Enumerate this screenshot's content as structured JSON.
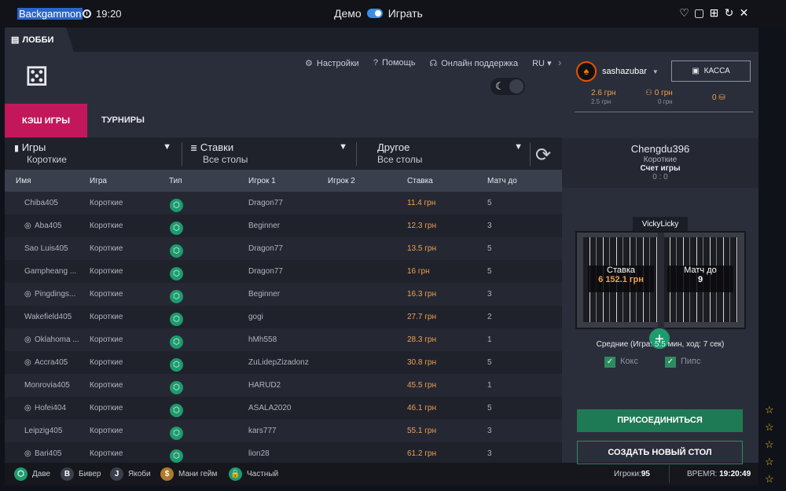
{
  "window": {
    "title": "Backgammon",
    "time": "19:20",
    "mode_demo": "Демо",
    "mode_play": "Играть"
  },
  "tabbar": {
    "lobby": "ЛОББИ"
  },
  "nav": {
    "settings": "Настройки",
    "help": "Помощь",
    "support": "Онлайн поддержка",
    "lang": "RU"
  },
  "tabs": {
    "cash": "КЭШ ИГРЫ",
    "tournaments": "ТУРНИРЫ"
  },
  "filters": [
    {
      "label": "Игры",
      "value": "Короткие"
    },
    {
      "label": "Ставки",
      "value": "Все столы"
    },
    {
      "label": "Другое",
      "value": "Все столы"
    }
  ],
  "columns": {
    "name": "Имя",
    "game": "Игра",
    "type": "Тип",
    "player1": "Игрок 1",
    "player2": "Игрок 2",
    "stake": "Ставка",
    "match": "Матч до"
  },
  "rows": [
    {
      "name": "Chiba405",
      "private": false,
      "game": "Короткие",
      "p1": "Dragon77",
      "stake": "11.4 грн",
      "match": "5"
    },
    {
      "name": "Aba405",
      "private": true,
      "game": "Короткие",
      "p1": "Beginner",
      "stake": "12.3 грн",
      "match": "3"
    },
    {
      "name": "Sao Luis405",
      "private": false,
      "game": "Короткие",
      "p1": "Dragon77",
      "stake": "13.5 грн",
      "match": "5"
    },
    {
      "name": "Gampheang ...",
      "private": false,
      "game": "Короткие",
      "p1": "Dragon77",
      "stake": "16 грн",
      "match": "5"
    },
    {
      "name": "Pingdings...",
      "private": true,
      "game": "Короткие",
      "p1": "Beginner",
      "stake": "16.3 грн",
      "match": "3"
    },
    {
      "name": "Wakefield405",
      "private": false,
      "game": "Короткие",
      "p1": "gogi",
      "stake": "27.7 грн",
      "match": "2"
    },
    {
      "name": "Oklahoma ...",
      "private": true,
      "game": "Короткие",
      "p1": "hMh558",
      "stake": "28.3 грн",
      "match": "1"
    },
    {
      "name": "Accra405",
      "private": true,
      "game": "Короткие",
      "p1": "ZuLidepZizadonz",
      "stake": "30.8 грн",
      "match": "5"
    },
    {
      "name": "Monrovia405",
      "private": false,
      "game": "Короткие",
      "p1": "HARUD2",
      "stake": "45.5 грн",
      "match": "1"
    },
    {
      "name": "Hofei404",
      "private": true,
      "game": "Короткие",
      "p1": "ASALA2020",
      "stake": "46.1 грн",
      "match": "5"
    },
    {
      "name": "Leipzig405",
      "private": false,
      "game": "Короткие",
      "p1": "kars777",
      "stake": "55.1 грн",
      "match": "3"
    },
    {
      "name": "Bari405",
      "private": true,
      "game": "Короткие",
      "p1": "lion28",
      "stake": "61.2 грн",
      "match": "3"
    }
  ],
  "legend": [
    {
      "icon": "⬡",
      "label": "Даве",
      "color": "#1e9b6e"
    },
    {
      "icon": "B",
      "label": "Бивер",
      "color": "#3a3f4d"
    },
    {
      "icon": "J",
      "label": "Якоби",
      "color": "#3a3f4d"
    },
    {
      "icon": "$",
      "label": "Мани гейм",
      "color": "#b07a2a"
    },
    {
      "icon": "🔒",
      "label": "Частный",
      "color": "#1e9b6e"
    }
  ],
  "status": {
    "players_label": "Игроки:",
    "players_value": "95",
    "time_label": "ВРЕМЯ:",
    "time_value": "19:20:49"
  },
  "account": {
    "username": "sashazubar",
    "cashier": "КАССА",
    "balance_main": "2.6 грн",
    "balance_sub": "2.5 грн",
    "chips": "0 грн",
    "chips_sub": "0 грн",
    "coins": "0"
  },
  "table": {
    "name": "Chengdu396",
    "type": "Короткие",
    "score_label": "Счет игры",
    "score": "0 : 0",
    "player": "VickyLicky",
    "stake_label": "Ставка",
    "stake_value": "6 152.1 грн",
    "match_label": "Матч до",
    "match_value": "9",
    "average": "Средние (Игра: 5.5 мин, ход: 7 сек)",
    "check_cox": "Кокс",
    "check_pips": "Пипс",
    "join": "ПРИСОЕДИНИТЬСЯ",
    "create": "СОЗДАТЬ НОВЫЙ СТОЛ"
  }
}
